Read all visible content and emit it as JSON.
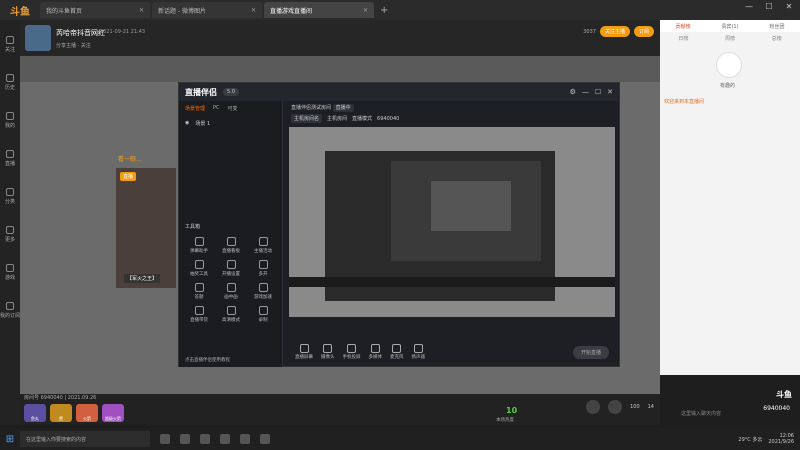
{
  "app": {
    "logo": "斗鱼"
  },
  "tabs": [
    {
      "label": "我的斗鱼首页",
      "active": false
    },
    {
      "label": "新话题 - 微博图片",
      "active": false
    },
    {
      "label": "直播游戏直播间",
      "active": true
    }
  ],
  "window_controls": {
    "minimize": "—",
    "maximize": "☐",
    "close": "✕"
  },
  "leftnav": [
    "关注",
    "历史",
    "我的",
    "直播",
    "分类",
    "更多",
    "游戏",
    "我的订阅"
  ],
  "header": {
    "streamer": "芮哈帝抖音网红",
    "meta": "2021-09-21 21:43",
    "sub": "分享主播 · 关注",
    "follow_btn": "关注主播",
    "fans": "3037",
    "subscribe_btn": "订阅"
  },
  "video": {
    "tip": "看一眼…",
    "live_tag": "直播",
    "preview_label": "【军火之王】"
  },
  "companion": {
    "logo": "直播伴侣",
    "version": "5.0",
    "left_tabs": [
      "场景管理",
      "PC",
      "可变"
    ],
    "scene": "场景 1",
    "tools_title": "工具箱",
    "tools": [
      "弹幕助手",
      "直播看板",
      "主播活动",
      "抽奖工具",
      "开播设置",
      "多开",
      "答题",
      "画中画",
      "游戏加速",
      "直播带货",
      "高清模式",
      "录制"
    ],
    "hint": "点击直播伴侣使用教程",
    "room_title": "直播伴侣测试房间",
    "room_status": "直播中",
    "room_line2": [
      "主机房间名",
      "主机房间",
      "直播模式",
      "6940040"
    ],
    "bottom_tools": [
      "直播屏幕",
      "摄像头",
      "手机投屏",
      "多媒体",
      "麦克风",
      "扬声器"
    ],
    "start_label": "开始直播"
  },
  "bottom": {
    "room_id": "房间号 6940040 | 2021.09.26",
    "gifts": [
      "鱼丸",
      "赞",
      "火箭",
      "超级火箭"
    ],
    "heat": "10",
    "heat_label": "本场热度",
    "right": [
      "100",
      "14"
    ]
  },
  "chat": {
    "tabs": [
      "贡献榜",
      "贵宾(1)",
      "粉丝团"
    ],
    "rank_tabs": [
      "日榜",
      "周榜",
      "总榜"
    ],
    "top_name": "有趣的",
    "message": "欢迎来到本直播间",
    "input_placeholder": "这里输入聊天内容",
    "badge": "斗鱼",
    "room_id": "6940040"
  },
  "taskbar": {
    "search_placeholder": "在这里输入你要搜索的内容",
    "weather": "29°C 多云",
    "time": "12:06",
    "date": "2021/9/26"
  }
}
